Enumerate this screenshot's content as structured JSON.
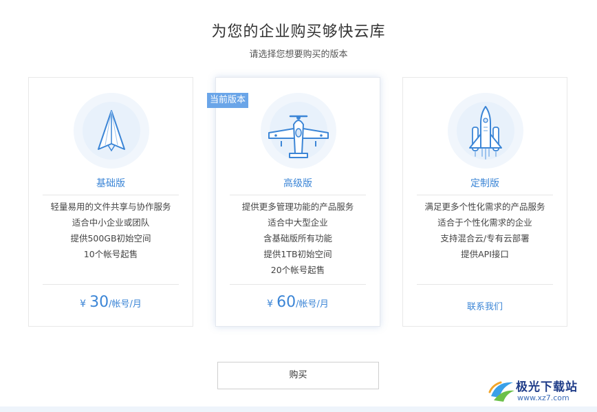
{
  "header": {
    "title": "为您的企业购买够快云库",
    "subtitle": "请选择您想要购买的版本"
  },
  "plans": [
    {
      "name": "基础版",
      "icon": "paper-plane-icon",
      "features": [
        "轻量易用的文件共享与协作服务",
        "适合中小企业或团队",
        "提供500GB初始空间",
        "10个帐号起售"
      ],
      "price": {
        "currency": "¥",
        "amount": "30",
        "unit": "/帐号/月"
      }
    },
    {
      "name": "高级版",
      "badge": "当前版本",
      "icon": "airplane-icon",
      "features": [
        "提供更多管理功能的产品服务",
        "适合中大型企业",
        "含基础版所有功能",
        "提供1TB初始空间",
        "20个帐号起售"
      ],
      "price": {
        "currency": "¥",
        "amount": "60",
        "unit": "/帐号/月"
      }
    },
    {
      "name": "定制版",
      "icon": "space-shuttle-icon",
      "features": [
        "满足更多个性化需求的产品服务",
        "适合于个性化需求的企业",
        "支持混合云/专有云部署",
        "提供API接口"
      ],
      "contact": "联系我们"
    }
  ],
  "actions": {
    "buy_label": "购买"
  },
  "watermark": {
    "title": "极光下载站",
    "url": "www.xz7.com"
  },
  "colors": {
    "accent": "#3b85d6",
    "badge": "#6aa5e8",
    "icon_bg": "#e8f1fb"
  }
}
